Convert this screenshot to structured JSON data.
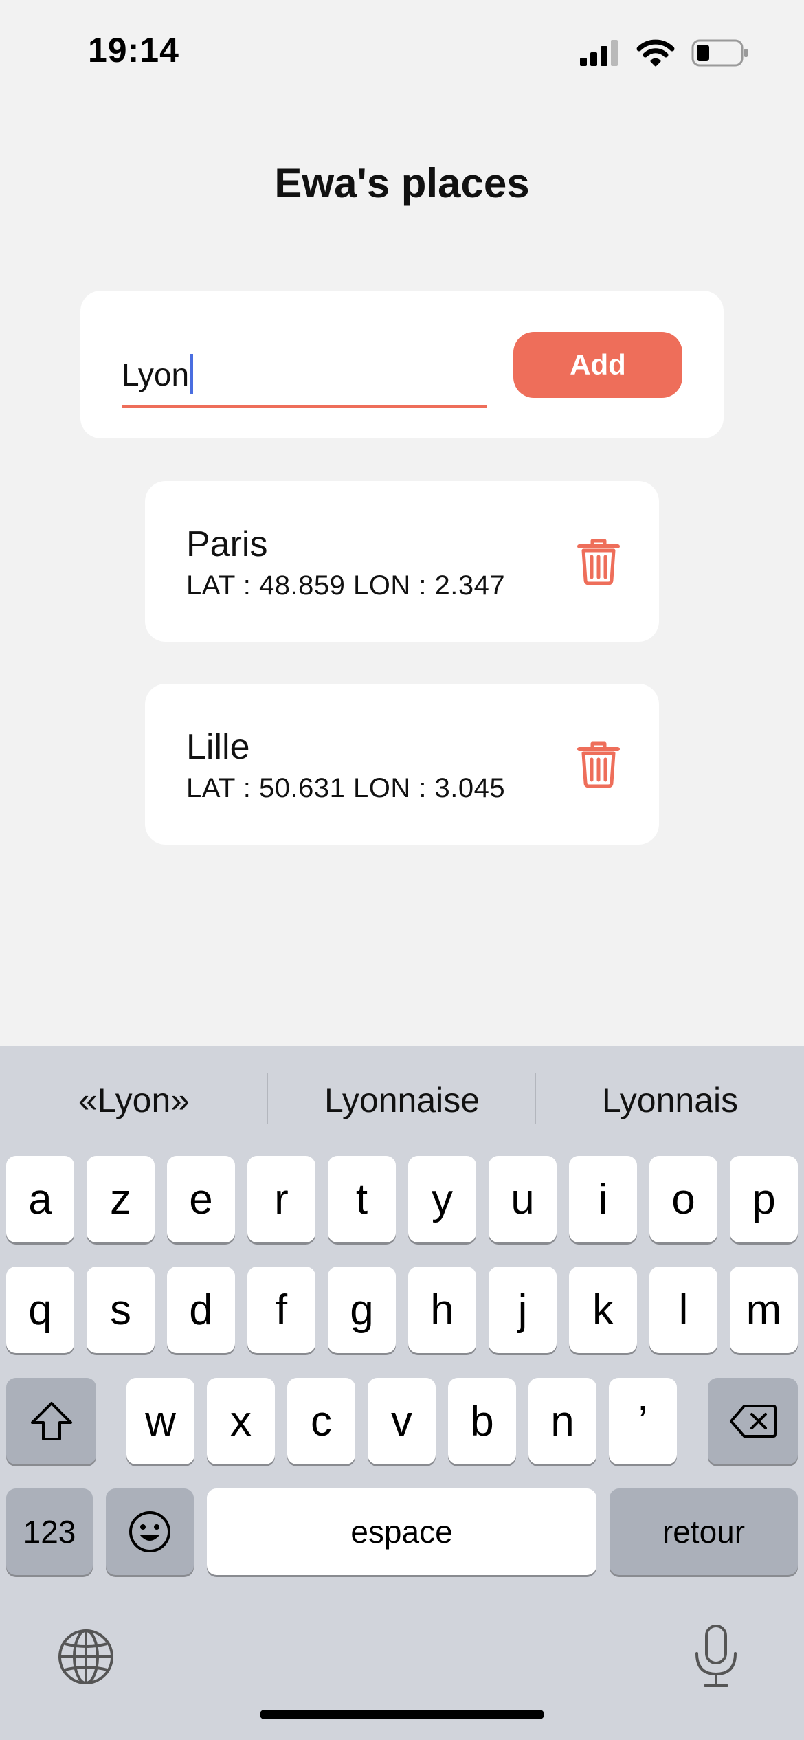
{
  "status_bar": {
    "time": "19:14"
  },
  "header": {
    "title": "Ewa's places"
  },
  "add_form": {
    "input_value": "Lyon",
    "add_label": "Add"
  },
  "places": [
    {
      "name": "Paris",
      "coords": "LAT : 48.859 LON : 2.347"
    },
    {
      "name": "Lille",
      "coords": "LAT : 50.631 LON : 3.045"
    }
  ],
  "keyboard": {
    "suggestions": [
      "«Lyon»",
      "Lyonnaise",
      "Lyonnais"
    ],
    "row1": [
      "a",
      "z",
      "e",
      "r",
      "t",
      "y",
      "u",
      "i",
      "o",
      "p"
    ],
    "row2": [
      "q",
      "s",
      "d",
      "f",
      "g",
      "h",
      "j",
      "k",
      "l",
      "m"
    ],
    "row3": [
      "w",
      "x",
      "c",
      "v",
      "b",
      "n",
      "’"
    ],
    "numbers_label": "123",
    "space_label": "espace",
    "return_label": "retour"
  },
  "colors": {
    "accent": "#ee6e5a",
    "background": "#f2f2f2",
    "keyboard": "#d1d4db"
  }
}
